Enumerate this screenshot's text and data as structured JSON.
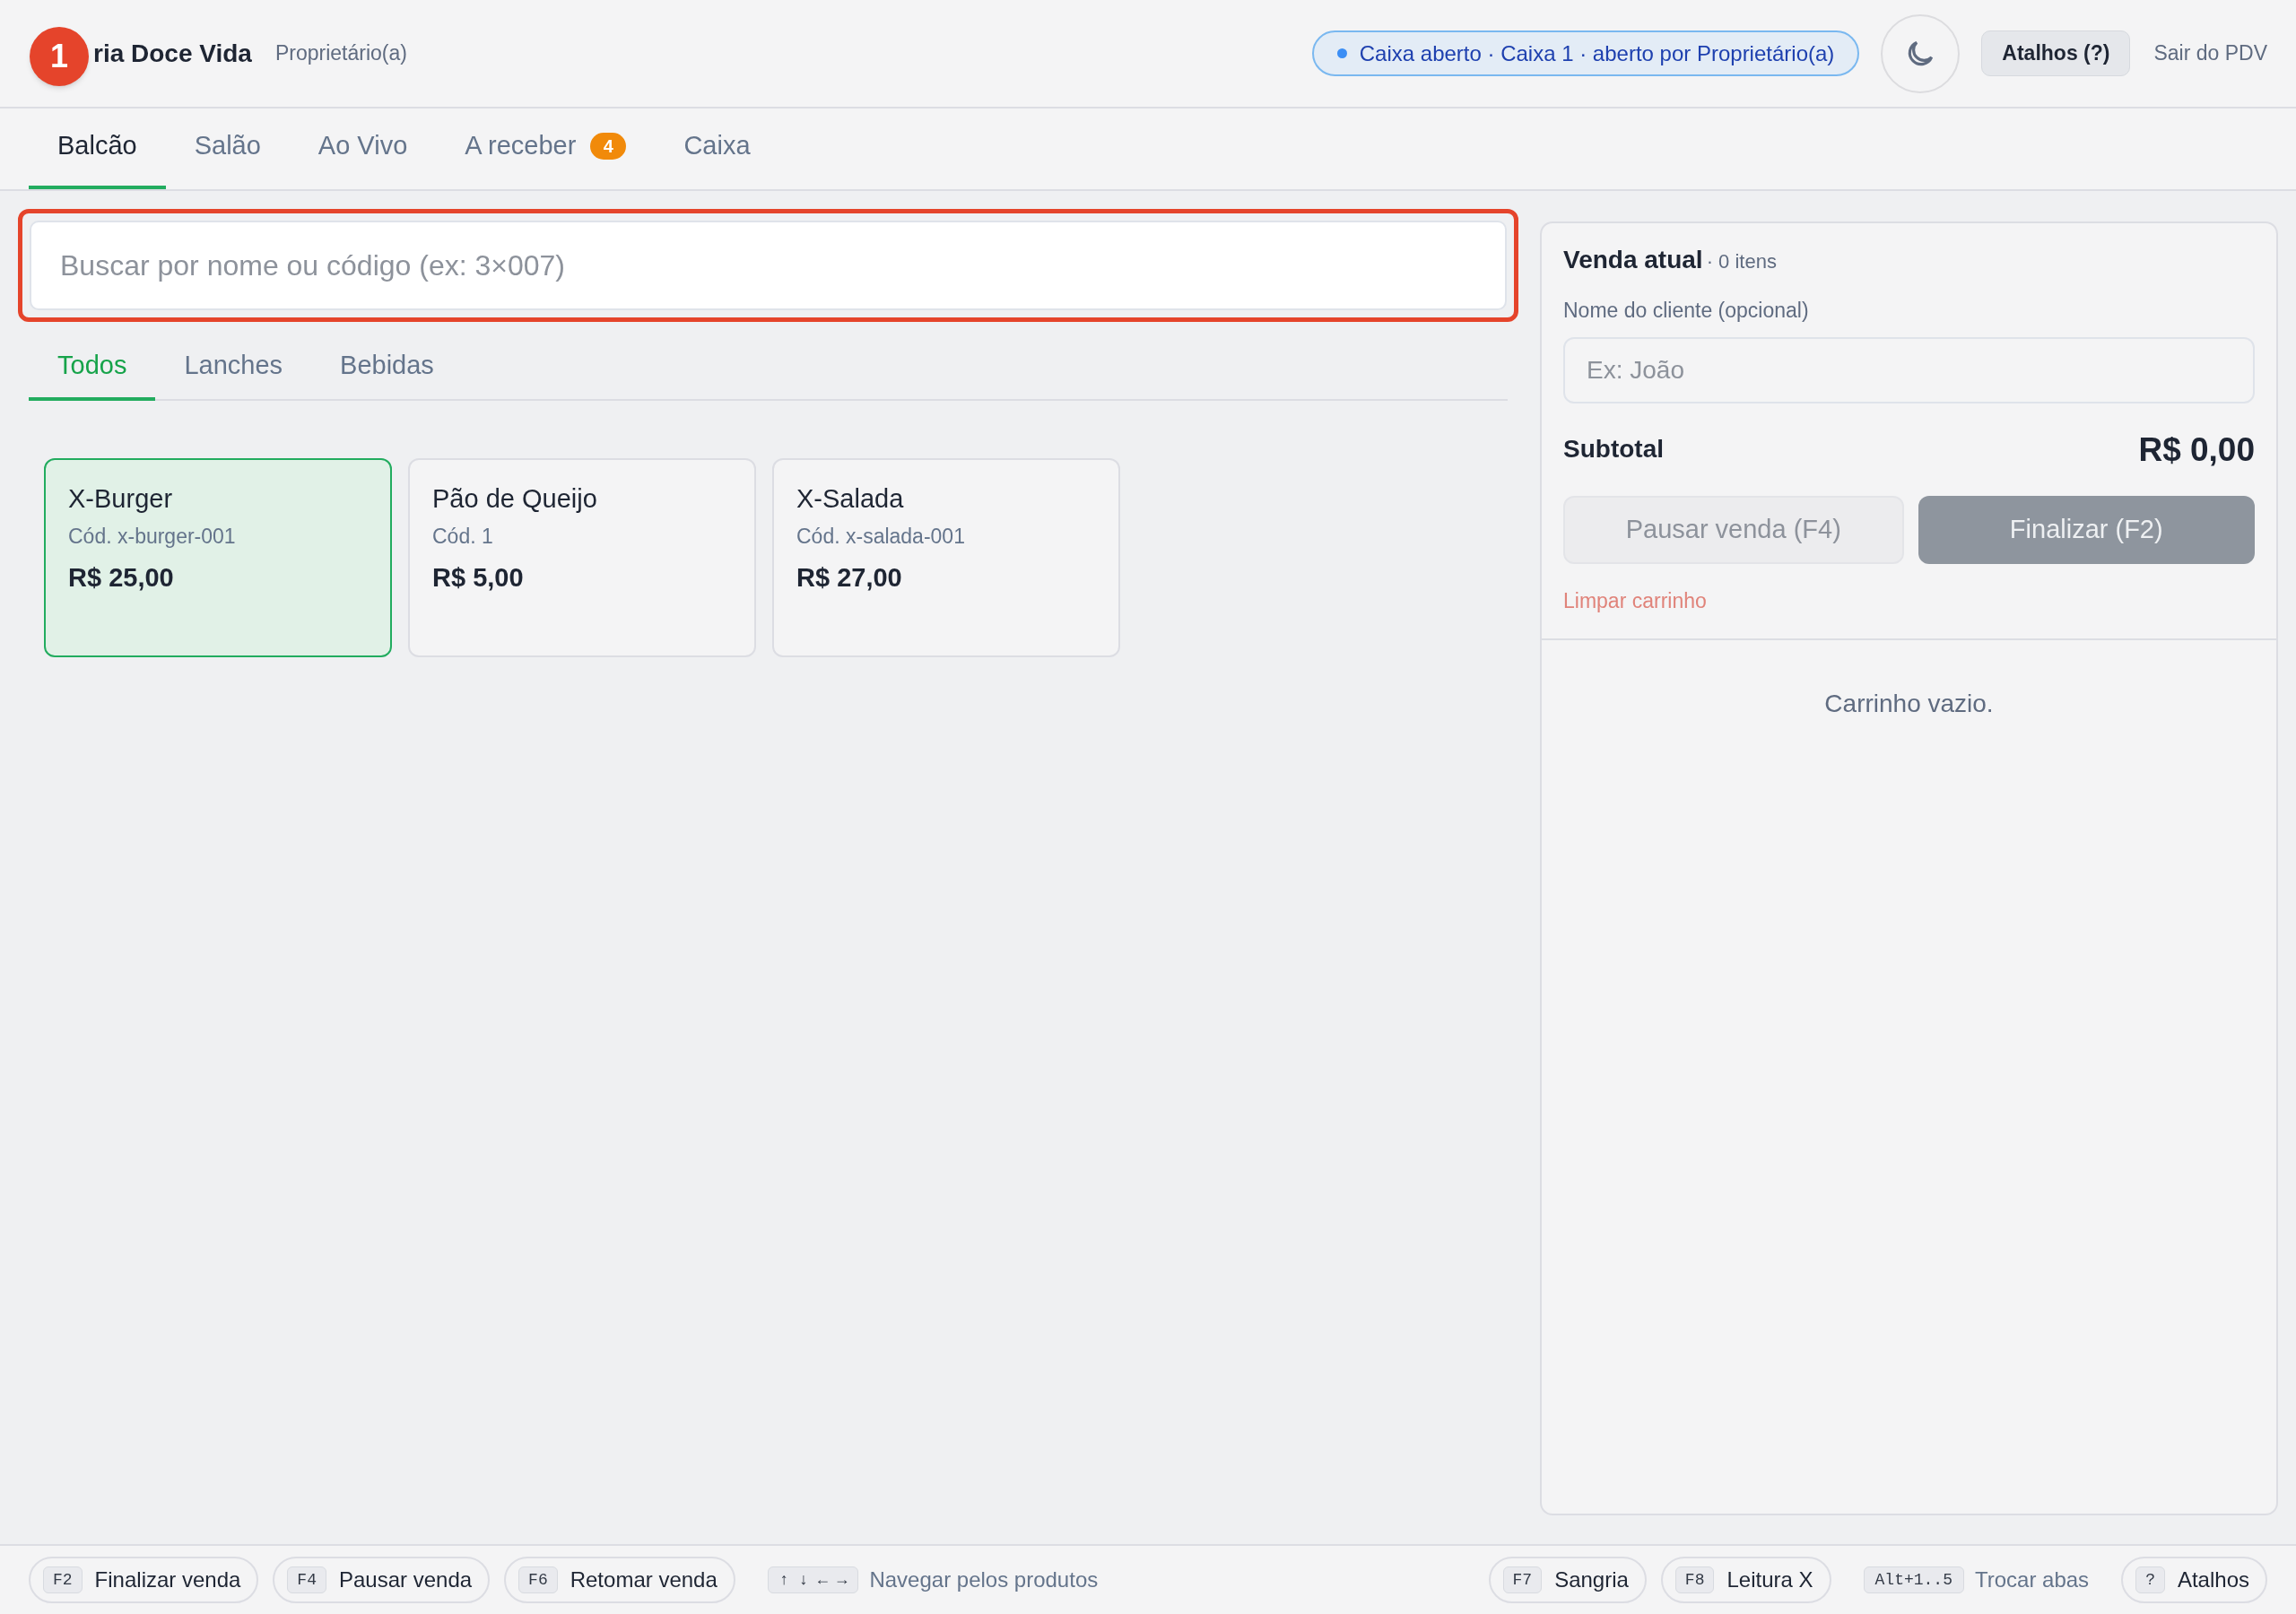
{
  "header": {
    "marker": "1",
    "title": "ria Doce Vida",
    "role": "Proprietário(a)",
    "status": {
      "text": "Caixa aberto · Caixa 1 · aberto por Proprietário(a)",
      "open": true
    },
    "shortcuts_button": "Atalhos (?)",
    "exit_link": "Sair do PDV"
  },
  "tabs": [
    {
      "label": "Balcão",
      "selected": true
    },
    {
      "label": "Salão",
      "selected": false
    },
    {
      "label": "Ao Vivo",
      "selected": false
    },
    {
      "label": "A receber",
      "badge": "4",
      "selected": false
    },
    {
      "label": "Caixa",
      "selected": false
    }
  ],
  "search": {
    "placeholder": "Buscar por nome ou código (ex: 3×007)",
    "highlighted": true
  },
  "categories": [
    {
      "label": "Todos",
      "selected": true
    },
    {
      "label": "Lanches",
      "selected": false
    },
    {
      "label": "Bebidas",
      "selected": false
    }
  ],
  "products": [
    {
      "name": "X-Burger",
      "code": "Cód. x-burger-001",
      "price": "R$ 25,00",
      "selected": true
    },
    {
      "name": "Pão de Queijo",
      "code": "Cód. 1",
      "price": "R$ 5,00",
      "selected": false
    },
    {
      "name": "X-Salada",
      "code": "Cód. x-salada-001",
      "price": "R$ 27,00",
      "selected": false
    }
  ],
  "sale": {
    "title": "Venda atual",
    "count": "· 0 itens",
    "customer_label": "Nome do cliente (opcional)",
    "customer_placeholder": "Ex: João",
    "subtotal_label": "Subtotal",
    "subtotal": "R$ 0,00",
    "pause_button": {
      "label": "Pausar venda (F4)",
      "disabled": true
    },
    "finish_button": {
      "label": "Finalizar (F2)",
      "disabled": true
    },
    "clear_link": "Limpar carrinho",
    "empty_text": "Carrinho vazio."
  },
  "footer": {
    "left": [
      {
        "kind": "button",
        "key": "F2",
        "label": "Finalizar venda"
      },
      {
        "kind": "button",
        "key": "F4",
        "label": "Pausar venda"
      },
      {
        "kind": "button",
        "key": "F6",
        "label": "Retomar venda"
      },
      {
        "kind": "hint",
        "key": "↑ ↓ ← →",
        "label": "Navegar pelos produtos"
      }
    ],
    "right": [
      {
        "kind": "button",
        "key": "F7",
        "label": "Sangria"
      },
      {
        "kind": "button",
        "key": "F8",
        "label": "Leitura X"
      },
      {
        "kind": "hint",
        "key": "Alt+1..5",
        "label": "Trocar abas"
      },
      {
        "kind": "button",
        "key": "?",
        "label": "Atalhos"
      }
    ]
  }
}
